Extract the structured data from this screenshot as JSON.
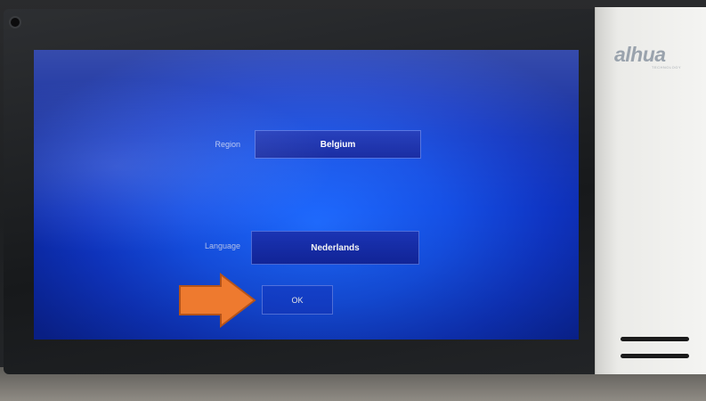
{
  "device": {
    "brand_logo": "alhua",
    "brand_subtitle": "TECHNOLOGY"
  },
  "settings_form": {
    "region_label": "Region",
    "region_value": "Belgium",
    "language_label": "Language",
    "language_value": "Nederlands",
    "ok_label": "OK"
  },
  "annotation": {
    "arrow_color": "#ee7a2f",
    "arrow_outline": "#b4531a",
    "arrow_icon": "right-arrow-icon"
  },
  "colors": {
    "screen_blue": "#1550e6",
    "field_blue": "#1226a0",
    "panel_white": "#f4f4f2"
  }
}
